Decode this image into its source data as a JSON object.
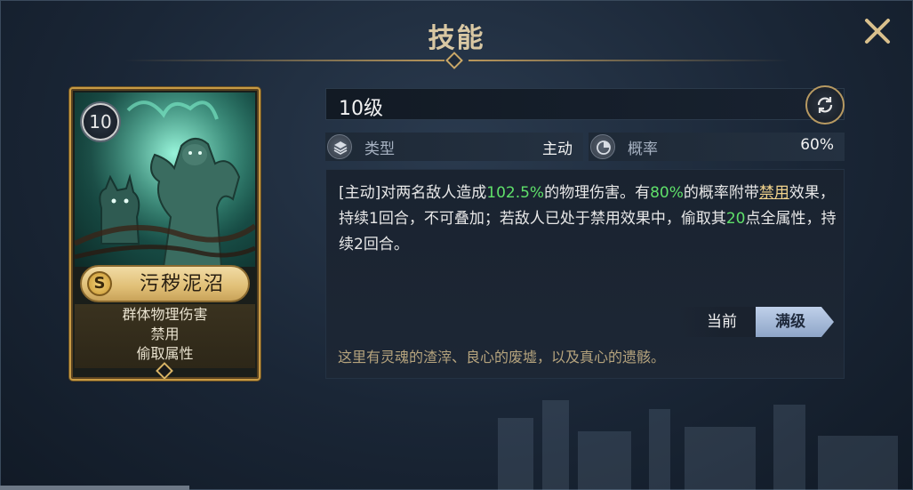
{
  "header": {
    "title": "技能"
  },
  "card": {
    "level": "10",
    "rank_badge": "S",
    "name": "污秽泥沼",
    "tags": [
      "群体物理伤害",
      "禁用",
      "偷取属性"
    ]
  },
  "skill": {
    "level_label": "10级",
    "type_label": "类型",
    "type_value": "主动",
    "chance_label": "概率",
    "chance_value": "60%",
    "description": {
      "p1": "[主动]对两名敌人造成",
      "p2": "102.5%",
      "p3": "的物理伤害。有",
      "p4": "80%",
      "p5": "的概率附带",
      "p6": "禁用",
      "p7": "效果，持续1回合，不可叠加；若敌人已处于禁用效果中，偷取其",
      "p8": "20",
      "p9": "点全属性，持续2回合。"
    },
    "toggle": {
      "current_label": "当前",
      "max_label": "满级"
    },
    "flavor": "这里有灵魂的渣滓、良心的废墟，以及真心的遗骸。"
  },
  "icons": {
    "close": "close-icon",
    "refresh": "refresh-icon",
    "type": "layers-icon",
    "chance": "pie-chart-icon"
  },
  "colors": {
    "highlight_green": "#5fe06a",
    "gold_title": "#d9c8a3",
    "card_border": "#c79b45"
  }
}
